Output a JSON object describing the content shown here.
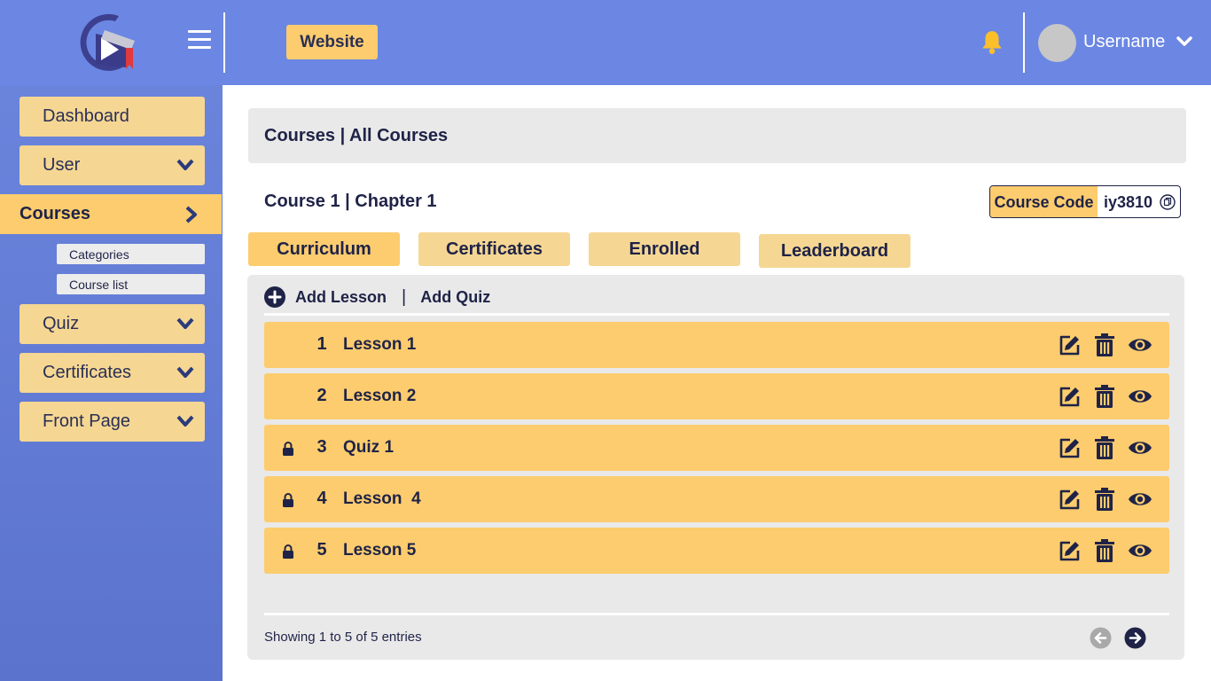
{
  "header": {
    "website_label": "Website",
    "username": "Username",
    "icons": {
      "menu": "hamburger-icon",
      "bell": "bell-icon",
      "user_menu": "chevron-down-icon"
    },
    "colors": {
      "background": "#6b87e3",
      "accent": "#fccc6e",
      "bell": "#fbbf2c"
    }
  },
  "sidebar": {
    "items": [
      {
        "label": "Dashboard"
      },
      {
        "label": "User"
      },
      {
        "label": "Courses",
        "active": true
      },
      {
        "label": "Quiz"
      },
      {
        "label": "Certificates"
      },
      {
        "label": "Front Page"
      }
    ],
    "subitems": [
      {
        "label": "Categories"
      },
      {
        "label": "Course list"
      }
    ]
  },
  "main": {
    "breadcrumb": "Courses | All Courses",
    "chapter_title": "Course 1 | Chapter 1",
    "course_code_label": "Course Code",
    "course_code": "iy3810",
    "tabs": [
      {
        "label": "Curriculum",
        "active": true
      },
      {
        "label": "Certificates"
      },
      {
        "label": "Enrolled"
      },
      {
        "label": "Leaderboard"
      }
    ],
    "add_lesson": "Add Lesson",
    "separator": "|",
    "add_quiz": "Add Quiz",
    "rows": [
      {
        "number": "1",
        "title": "Lesson 1",
        "locked": false
      },
      {
        "number": "2",
        "title": "Lesson 2",
        "locked": false
      },
      {
        "number": "3",
        "title": "Quiz 1",
        "locked": true
      },
      {
        "number": "4",
        "title": "Lesson  4",
        "locked": true
      },
      {
        "number": "5",
        "title": "Lesson 5",
        "locked": true
      }
    ],
    "row_actions": [
      "edit-icon",
      "trash-icon",
      "eye-icon"
    ],
    "footer": "Showing 1 to 5 of 5 entries"
  }
}
